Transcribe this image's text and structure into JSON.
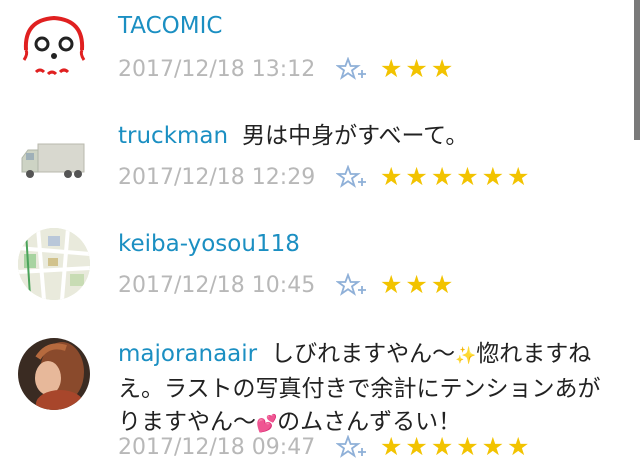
{
  "colors": {
    "username": "#1b8fc2",
    "timestamp": "#b8b8b8",
    "star": "#f2c300",
    "fav_icon": "#8fb0d8"
  },
  "comments": [
    {
      "username": "TACOMIC",
      "text": "",
      "timestamp": "2017/12/18 13:12",
      "fav_icon": "star-plus-icon",
      "stars": 3,
      "stars_display": "★★★",
      "avatar": "octopus-avatar"
    },
    {
      "username": "truckman",
      "text": "男は中身がすべーて。",
      "timestamp": "2017/12/18 12:29",
      "fav_icon": "star-plus-icon",
      "stars": 6,
      "stars_display": "★★★★★★",
      "avatar": "truck-avatar"
    },
    {
      "username": "keiba-yosou118",
      "text": "",
      "timestamp": "2017/12/18 10:45",
      "fav_icon": "star-plus-icon",
      "stars": 3,
      "stars_display": "★★★",
      "avatar": "map-avatar"
    },
    {
      "username": "majoranaair",
      "text_a": "しびれますやん〜",
      "emoji_a": "✨",
      "text_b": "惚れますねえ。ラストの写真付きで余計にテンションあがりますやん〜",
      "emoji_b": "💕",
      "text_c": "のムさんずるい！",
      "timestamp": "2017/12/18 09:47",
      "fav_icon": "star-plus-icon",
      "stars": 6,
      "stars_display": "★★★★★★",
      "avatar": "photo-avatar"
    }
  ]
}
